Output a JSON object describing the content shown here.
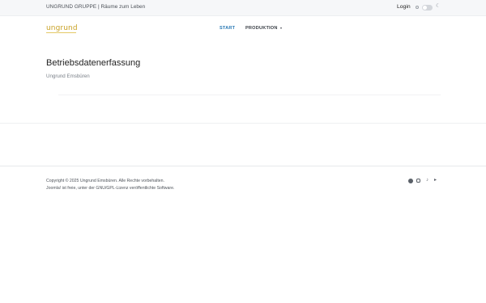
{
  "topbar": {
    "brand_text": "UNGRUND GRUPPE | Räume zum Leben",
    "login_label": "Login"
  },
  "header": {
    "logo_text": "ungrund",
    "nav": [
      {
        "label": "START"
      },
      {
        "label": "PRODUKTION"
      }
    ]
  },
  "main": {
    "title": "Betriebsdatenerfassung",
    "subtitle": "Ungrund Emsbüren"
  },
  "footer": {
    "copyright": "Copyright © 2025 Ungrund Emsbüren. Alle Rechte vorbehalten.",
    "license": "Joomla! ist freie, unter der GNU/GPL-Lizenz veröffentlichte Software."
  },
  "colors": {
    "accent": "#2a7ab5",
    "logo": "#c9a227",
    "topbar_bg": "#f6f7f9"
  },
  "icons": [
    "sun-icon",
    "theme-toggle",
    "moon-icon",
    "facebook-icon",
    "instagram-icon",
    "tiktok-icon",
    "twitter-icon"
  ]
}
